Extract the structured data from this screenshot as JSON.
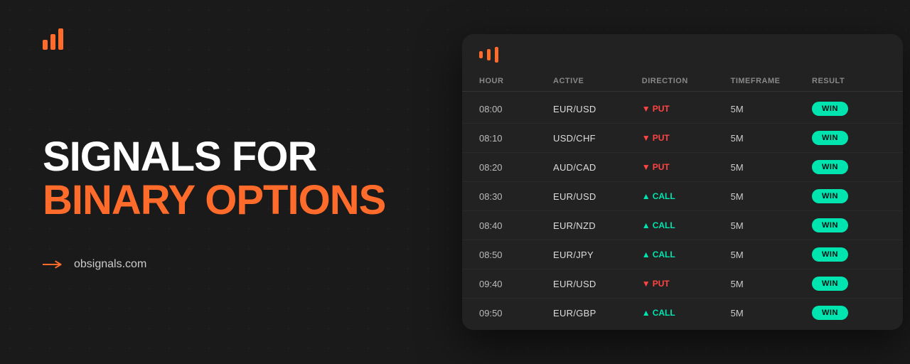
{
  "logo": {
    "alt": "OB Signals Logo"
  },
  "headline": {
    "line1": "SIGNALS FOR",
    "line2": "BINARY OPTIONS"
  },
  "website": {
    "label": "obsignals.com"
  },
  "card": {
    "columns": [
      "HOUR",
      "ACTIVE",
      "DIRECTION",
      "TIMEFRAME",
      "RESULT"
    ],
    "rows": [
      {
        "hour": "08:00",
        "active": "EUR/USD",
        "direction": "PUT",
        "direction_type": "put",
        "timeframe": "5M",
        "result": "WIN"
      },
      {
        "hour": "08:10",
        "active": "USD/CHF",
        "direction": "PUT",
        "direction_type": "put",
        "timeframe": "5M",
        "result": "WIN"
      },
      {
        "hour": "08:20",
        "active": "AUD/CAD",
        "direction": "PUT",
        "direction_type": "put",
        "timeframe": "5M",
        "result": "WIN"
      },
      {
        "hour": "08:30",
        "active": "EUR/USD",
        "direction": "CALL",
        "direction_type": "call",
        "timeframe": "5M",
        "result": "WIN"
      },
      {
        "hour": "08:40",
        "active": "EUR/NZD",
        "direction": "CALL",
        "direction_type": "call",
        "timeframe": "5M",
        "result": "WIN"
      },
      {
        "hour": "08:50",
        "active": "EUR/JPY",
        "direction": "CALL",
        "direction_type": "call",
        "timeframe": "5M",
        "result": "WIN"
      },
      {
        "hour": "09:40",
        "active": "EUR/USD",
        "direction": "PUT",
        "direction_type": "put",
        "timeframe": "5M",
        "result": "WIN"
      },
      {
        "hour": "09:50",
        "active": "EUR/GBP",
        "direction": "CALL",
        "direction_type": "call",
        "timeframe": "5M",
        "result": "WIN"
      }
    ]
  }
}
